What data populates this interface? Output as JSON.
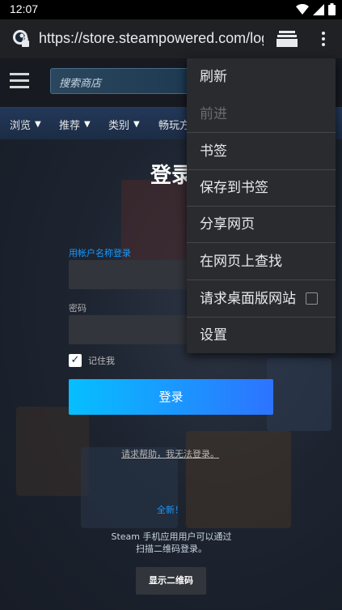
{
  "status_bar": {
    "time": "12:07"
  },
  "browser": {
    "url": "https://store.steampowered.com/login/?redir="
  },
  "steam_header": {
    "search_placeholder": "搜索商店"
  },
  "nav": {
    "items": [
      "浏览",
      "推荐",
      "类别",
      "畅玩方"
    ]
  },
  "login": {
    "title": "登录",
    "account_label": "用帐户名称登录",
    "password_label": "密码",
    "remember_label": "记住我",
    "remember_checked": true,
    "submit_label": "登录",
    "help_link": "请求帮助，我无法登录。",
    "new_badge": "全新！",
    "qr_desc_line1": "Steam 手机应用用户可以通过",
    "qr_desc_line2": "扫描二维码登录。",
    "qr_button": "显示二维码"
  },
  "menu": {
    "refresh": "刷新",
    "forward": "前进",
    "bookmarks": "书签",
    "save_bookmark": "保存到书签",
    "share": "分享网页",
    "find": "在网页上查找",
    "desktop_site": "请求桌面版网站",
    "settings": "设置"
  }
}
